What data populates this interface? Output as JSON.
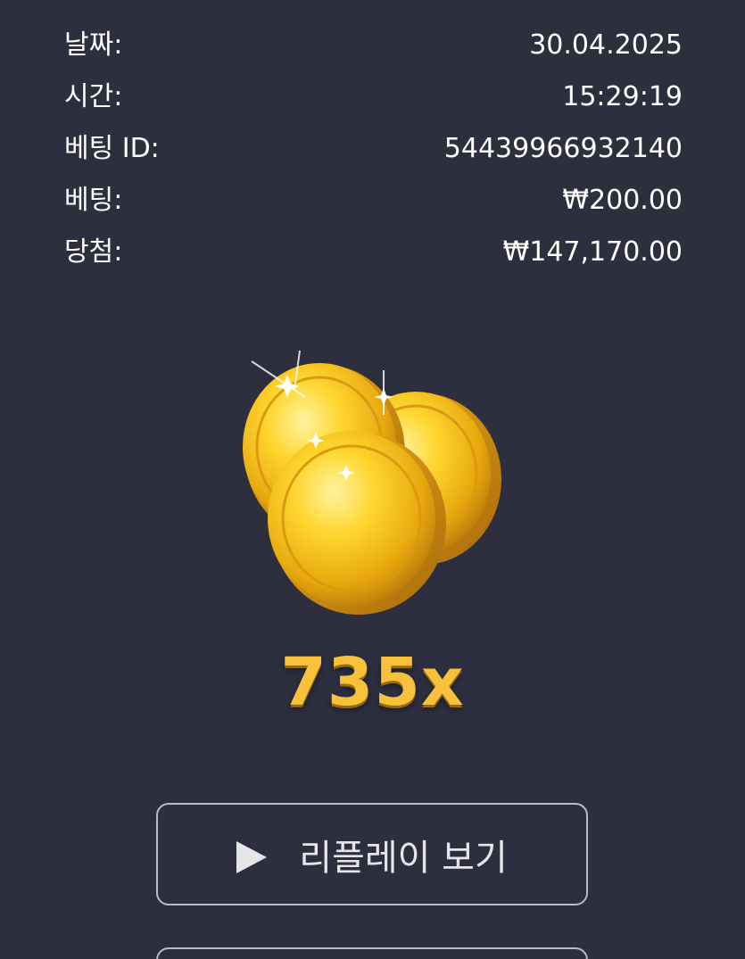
{
  "details": [
    {
      "label": "날짜:",
      "value": "30.04.2025"
    },
    {
      "label": "시간:",
      "value": "15:29:19"
    },
    {
      "label": "베팅 ID:",
      "value": "54439966932140"
    },
    {
      "label": "베팅:",
      "value": "₩200.00"
    },
    {
      "label": "당첨:",
      "value": "₩147,170.00"
    }
  ],
  "win": {
    "multiplier": "735x",
    "icon": "gold-coins-icon"
  },
  "buttons": {
    "replay_label": "리플레이 보기",
    "replay_icon": "play-icon"
  },
  "colors": {
    "background": "#2d2f3f",
    "gold": "#f7c13c",
    "border": "#b9bac4"
  }
}
